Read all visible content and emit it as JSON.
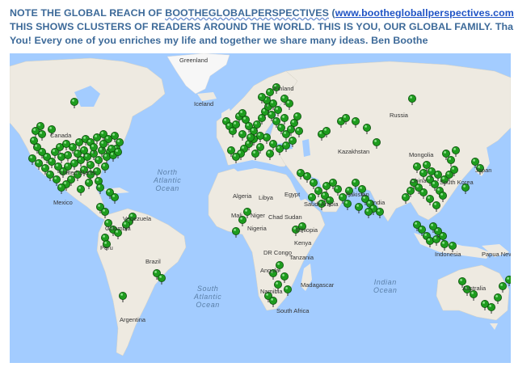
{
  "caption": {
    "line1_prefix": "NOTE THE GLOBAL REACH OF ",
    "line1_brand": "BOOTHEGLOBALPERSPECTIVES",
    "line1_open": "  (",
    "line1_url": "www.boothegloballperspectives.com",
    "line1_close": ")",
    "line2": "THIS SHOWS CLUSTERS OF READERS AROUND THE WORLD.  THIS IS YOU, OUR GLOBAL FAMILY. Thank",
    "line3": "You!  Every one of you enriches my life and together we share many ideas.   Ben Boothe"
  },
  "map": {
    "colors": {
      "ocean": "#a3ccff",
      "land": "#eeeae1",
      "greenland": "#f7f7f7",
      "marker": "#1e9c1e",
      "marker_outline": "#0d4d0d"
    },
    "oceans": {
      "north_atlantic": "North\nAtlantic\nOcean",
      "south_atlantic": "South\nAtlantic\nOcean",
      "indian": "Indian\nOcean"
    },
    "places": {
      "greenland": "Greenland",
      "iceland": "Iceland",
      "finland": "Finland",
      "russia": "Russia",
      "canada": "Canada",
      "kazakhstan": "Kazakhstan",
      "mongolia": "Mongolia",
      "china": "China",
      "south_korea": "South Korea",
      "japan": "Japan",
      "united_states": "United States",
      "mexico": "Mexico",
      "algeria": "Algeria",
      "libya": "Libya",
      "egypt": "Egypt",
      "saudi_arabia": "Saudi Arabia",
      "pakistan": "Pakistan",
      "india": "India",
      "mali": "Mali",
      "niger": "Niger",
      "chad": "Chad",
      "sudan": "Sudan",
      "nigeria": "Nigeria",
      "ethiopia": "Ethiopia",
      "venezuela": "Venezuela",
      "colombia": "Colombia",
      "kenya": "Kenya",
      "dr_congo": "DR Congo",
      "tanzania": "Tanzania",
      "peru": "Peru",
      "brazil": "Brazil",
      "angola": "Angola",
      "namibia": "Namibia",
      "madagascar": "Madagascar",
      "south_africa": "South Africa",
      "argentina": "Argentina",
      "indonesia": "Indonesia",
      "papua_new_guinea": "Papua New Guinea",
      "australia": "Australia"
    },
    "marker_count": 228
  }
}
